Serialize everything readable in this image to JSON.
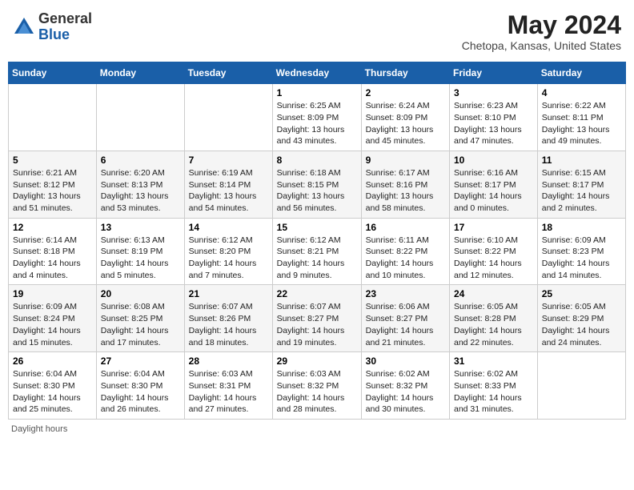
{
  "header": {
    "logo_general": "General",
    "logo_blue": "Blue",
    "month_year": "May 2024",
    "location": "Chetopa, Kansas, United States"
  },
  "days_of_week": [
    "Sunday",
    "Monday",
    "Tuesday",
    "Wednesday",
    "Thursday",
    "Friday",
    "Saturday"
  ],
  "weeks": [
    [
      {
        "day": "",
        "sunrise": "",
        "sunset": "",
        "daylight": ""
      },
      {
        "day": "",
        "sunrise": "",
        "sunset": "",
        "daylight": ""
      },
      {
        "day": "",
        "sunrise": "",
        "sunset": "",
        "daylight": ""
      },
      {
        "day": "1",
        "sunrise": "Sunrise: 6:25 AM",
        "sunset": "Sunset: 8:09 PM",
        "daylight": "Daylight: 13 hours and 43 minutes."
      },
      {
        "day": "2",
        "sunrise": "Sunrise: 6:24 AM",
        "sunset": "Sunset: 8:09 PM",
        "daylight": "Daylight: 13 hours and 45 minutes."
      },
      {
        "day": "3",
        "sunrise": "Sunrise: 6:23 AM",
        "sunset": "Sunset: 8:10 PM",
        "daylight": "Daylight: 13 hours and 47 minutes."
      },
      {
        "day": "4",
        "sunrise": "Sunrise: 6:22 AM",
        "sunset": "Sunset: 8:11 PM",
        "daylight": "Daylight: 13 hours and 49 minutes."
      }
    ],
    [
      {
        "day": "5",
        "sunrise": "Sunrise: 6:21 AM",
        "sunset": "Sunset: 8:12 PM",
        "daylight": "Daylight: 13 hours and 51 minutes."
      },
      {
        "day": "6",
        "sunrise": "Sunrise: 6:20 AM",
        "sunset": "Sunset: 8:13 PM",
        "daylight": "Daylight: 13 hours and 53 minutes."
      },
      {
        "day": "7",
        "sunrise": "Sunrise: 6:19 AM",
        "sunset": "Sunset: 8:14 PM",
        "daylight": "Daylight: 13 hours and 54 minutes."
      },
      {
        "day": "8",
        "sunrise": "Sunrise: 6:18 AM",
        "sunset": "Sunset: 8:15 PM",
        "daylight": "Daylight: 13 hours and 56 minutes."
      },
      {
        "day": "9",
        "sunrise": "Sunrise: 6:17 AM",
        "sunset": "Sunset: 8:16 PM",
        "daylight": "Daylight: 13 hours and 58 minutes."
      },
      {
        "day": "10",
        "sunrise": "Sunrise: 6:16 AM",
        "sunset": "Sunset: 8:17 PM",
        "daylight": "Daylight: 14 hours and 0 minutes."
      },
      {
        "day": "11",
        "sunrise": "Sunrise: 6:15 AM",
        "sunset": "Sunset: 8:17 PM",
        "daylight": "Daylight: 14 hours and 2 minutes."
      }
    ],
    [
      {
        "day": "12",
        "sunrise": "Sunrise: 6:14 AM",
        "sunset": "Sunset: 8:18 PM",
        "daylight": "Daylight: 14 hours and 4 minutes."
      },
      {
        "day": "13",
        "sunrise": "Sunrise: 6:13 AM",
        "sunset": "Sunset: 8:19 PM",
        "daylight": "Daylight: 14 hours and 5 minutes."
      },
      {
        "day": "14",
        "sunrise": "Sunrise: 6:12 AM",
        "sunset": "Sunset: 8:20 PM",
        "daylight": "Daylight: 14 hours and 7 minutes."
      },
      {
        "day": "15",
        "sunrise": "Sunrise: 6:12 AM",
        "sunset": "Sunset: 8:21 PM",
        "daylight": "Daylight: 14 hours and 9 minutes."
      },
      {
        "day": "16",
        "sunrise": "Sunrise: 6:11 AM",
        "sunset": "Sunset: 8:22 PM",
        "daylight": "Daylight: 14 hours and 10 minutes."
      },
      {
        "day": "17",
        "sunrise": "Sunrise: 6:10 AM",
        "sunset": "Sunset: 8:22 PM",
        "daylight": "Daylight: 14 hours and 12 minutes."
      },
      {
        "day": "18",
        "sunrise": "Sunrise: 6:09 AM",
        "sunset": "Sunset: 8:23 PM",
        "daylight": "Daylight: 14 hours and 14 minutes."
      }
    ],
    [
      {
        "day": "19",
        "sunrise": "Sunrise: 6:09 AM",
        "sunset": "Sunset: 8:24 PM",
        "daylight": "Daylight: 14 hours and 15 minutes."
      },
      {
        "day": "20",
        "sunrise": "Sunrise: 6:08 AM",
        "sunset": "Sunset: 8:25 PM",
        "daylight": "Daylight: 14 hours and 17 minutes."
      },
      {
        "day": "21",
        "sunrise": "Sunrise: 6:07 AM",
        "sunset": "Sunset: 8:26 PM",
        "daylight": "Daylight: 14 hours and 18 minutes."
      },
      {
        "day": "22",
        "sunrise": "Sunrise: 6:07 AM",
        "sunset": "Sunset: 8:27 PM",
        "daylight": "Daylight: 14 hours and 19 minutes."
      },
      {
        "day": "23",
        "sunrise": "Sunrise: 6:06 AM",
        "sunset": "Sunset: 8:27 PM",
        "daylight": "Daylight: 14 hours and 21 minutes."
      },
      {
        "day": "24",
        "sunrise": "Sunrise: 6:05 AM",
        "sunset": "Sunset: 8:28 PM",
        "daylight": "Daylight: 14 hours and 22 minutes."
      },
      {
        "day": "25",
        "sunrise": "Sunrise: 6:05 AM",
        "sunset": "Sunset: 8:29 PM",
        "daylight": "Daylight: 14 hours and 24 minutes."
      }
    ],
    [
      {
        "day": "26",
        "sunrise": "Sunrise: 6:04 AM",
        "sunset": "Sunset: 8:30 PM",
        "daylight": "Daylight: 14 hours and 25 minutes."
      },
      {
        "day": "27",
        "sunrise": "Sunrise: 6:04 AM",
        "sunset": "Sunset: 8:30 PM",
        "daylight": "Daylight: 14 hours and 26 minutes."
      },
      {
        "day": "28",
        "sunrise": "Sunrise: 6:03 AM",
        "sunset": "Sunset: 8:31 PM",
        "daylight": "Daylight: 14 hours and 27 minutes."
      },
      {
        "day": "29",
        "sunrise": "Sunrise: 6:03 AM",
        "sunset": "Sunset: 8:32 PM",
        "daylight": "Daylight: 14 hours and 28 minutes."
      },
      {
        "day": "30",
        "sunrise": "Sunrise: 6:02 AM",
        "sunset": "Sunset: 8:32 PM",
        "daylight": "Daylight: 14 hours and 30 minutes."
      },
      {
        "day": "31",
        "sunrise": "Sunrise: 6:02 AM",
        "sunset": "Sunset: 8:33 PM",
        "daylight": "Daylight: 14 hours and 31 minutes."
      },
      {
        "day": "",
        "sunrise": "",
        "sunset": "",
        "daylight": ""
      }
    ]
  ],
  "footer": {
    "daylight_hours_label": "Daylight hours"
  }
}
